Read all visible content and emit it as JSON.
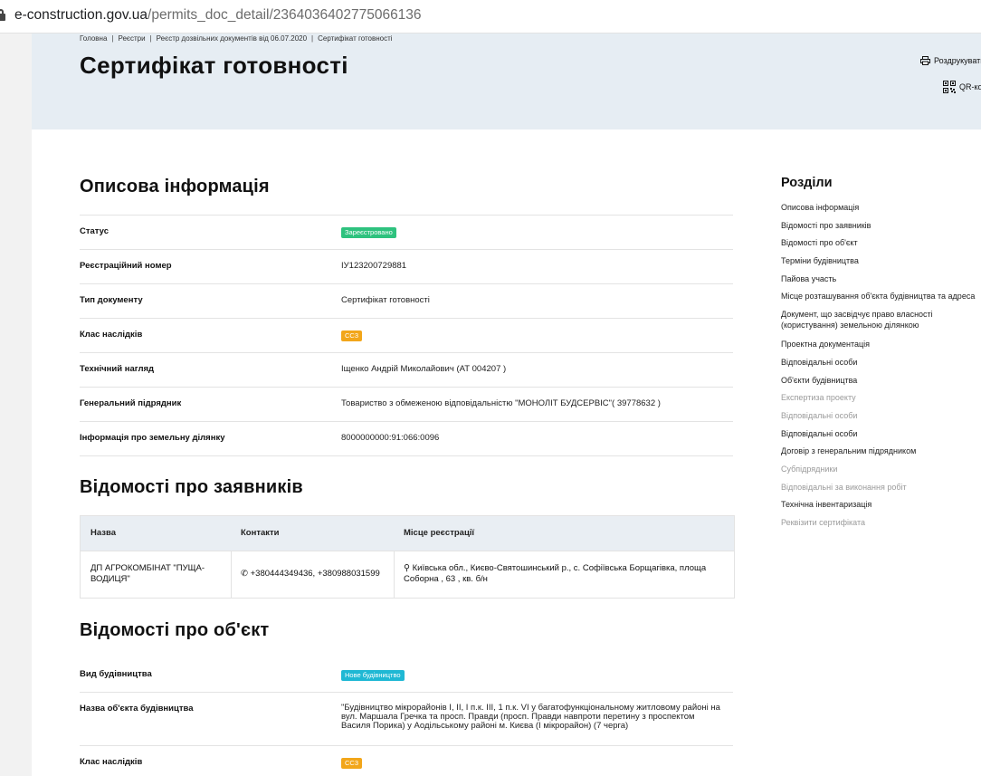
{
  "browser": {
    "url_domain": "e-construction.gov.ua",
    "url_path": "/permits_doc_detail/2364036402775066136"
  },
  "breadcrumb": [
    "Головна",
    "Реєстри",
    "Реєстр дозвільних документів від 06.07.2020",
    "Сертифікат готовності"
  ],
  "page": {
    "title": "Сертифікат готовності",
    "print_label": "Роздрукувати",
    "qr_label": "QR-код"
  },
  "desc": {
    "heading": "Описова інформація",
    "rows": [
      {
        "k": "Статус",
        "v": "Зареєстровано",
        "badge": "green"
      },
      {
        "k": "Реєстраційний номер",
        "v": "ІУ123200729881"
      },
      {
        "k": "Тип документу",
        "v": "Сертифікат готовності"
      },
      {
        "k": "Клас наслідків",
        "v": "СС3",
        "badge": "orange"
      },
      {
        "k": "Технічний нагляд",
        "v": "Іщенко Андрій Миколайович (АТ 004207 )"
      },
      {
        "k": "Генеральний підрядник",
        "v": "Товариство з обмеженою відповідальністю \"МОНОЛІТ БУДСЕРВІС\"( 39778632 )"
      },
      {
        "k": "Інформація про земельну ділянку",
        "v": "8000000000:91:066:0096"
      }
    ]
  },
  "applicants": {
    "heading": "Відомості про заявників",
    "cols": [
      "Назва",
      "Контакти",
      "Місце реєстрації"
    ],
    "row": {
      "name": "ДП АГРОКОМБІНАТ \"ПУЩА-ВОДИЦЯ\"",
      "contacts": "+380444349436, +380988031599",
      "place": "Київська обл., Києво-Святошинський р., с. Софіївська Борщагівка, площа Соборна , 63 , кв. б/н"
    }
  },
  "object": {
    "heading": "Відомості про об'єкт",
    "rows": [
      {
        "k": "Вид будівництва",
        "v": "Нове будівництво",
        "badge": "cyan"
      },
      {
        "k": "Назва об'єкта будівництва",
        "v": "\"Будівництво мікрорайонів І, ІІ, І п.к. ІІІ, 1 п.к. VІ у багатофункціональному житловому районі на вул. Маршала Гречка та просп. Правди (просп. Правди навпроти перетину з проспектом Василя Порика) у Аодільському районі м. Києва (І мікрорайон) (7 черга)"
      },
      {
        "k": "Клас наслідків",
        "v": "СС3",
        "badge": "orange"
      }
    ]
  },
  "sections": {
    "heading": "Розділи",
    "items": [
      {
        "label": "Описова інформація",
        "dim": false
      },
      {
        "label": "Відомості про заявників",
        "dim": false
      },
      {
        "label": "Відомості про об'єкт",
        "dim": false
      },
      {
        "label": "Терміни будівництва",
        "dim": false
      },
      {
        "label": "Пайова участь",
        "dim": false
      },
      {
        "label": "Місце розташування об'єкта будівництва та адреса",
        "dim": false
      },
      {
        "label": "Документ, що засвідчує право власності (користування) земельною ділянкою",
        "dim": false
      },
      {
        "label": "Проектна документація",
        "dim": false
      },
      {
        "label": "Відповідальні особи",
        "dim": false
      },
      {
        "label": "Об'єкти будівництва",
        "dim": false
      },
      {
        "label": "Експертиза проекту",
        "dim": true
      },
      {
        "label": "Відповідальні особи",
        "dim": true
      },
      {
        "label": "Відповідальні особи",
        "dim": false
      },
      {
        "label": "Договір з генеральним підрядником",
        "dim": false
      },
      {
        "label": "Субпідрядники",
        "dim": true
      },
      {
        "label": "Відповідальні за виконання робіт",
        "dim": true
      },
      {
        "label": "Технічна інвентаризація",
        "dim": false
      },
      {
        "label": "Реквізити сертифіката",
        "dim": true
      }
    ]
  },
  "colors": {
    "badge_green": "#2ec27e",
    "badge_orange": "#f2a61a",
    "badge_cyan": "#1fb8d4",
    "hero_bg": "#e6edf3"
  }
}
